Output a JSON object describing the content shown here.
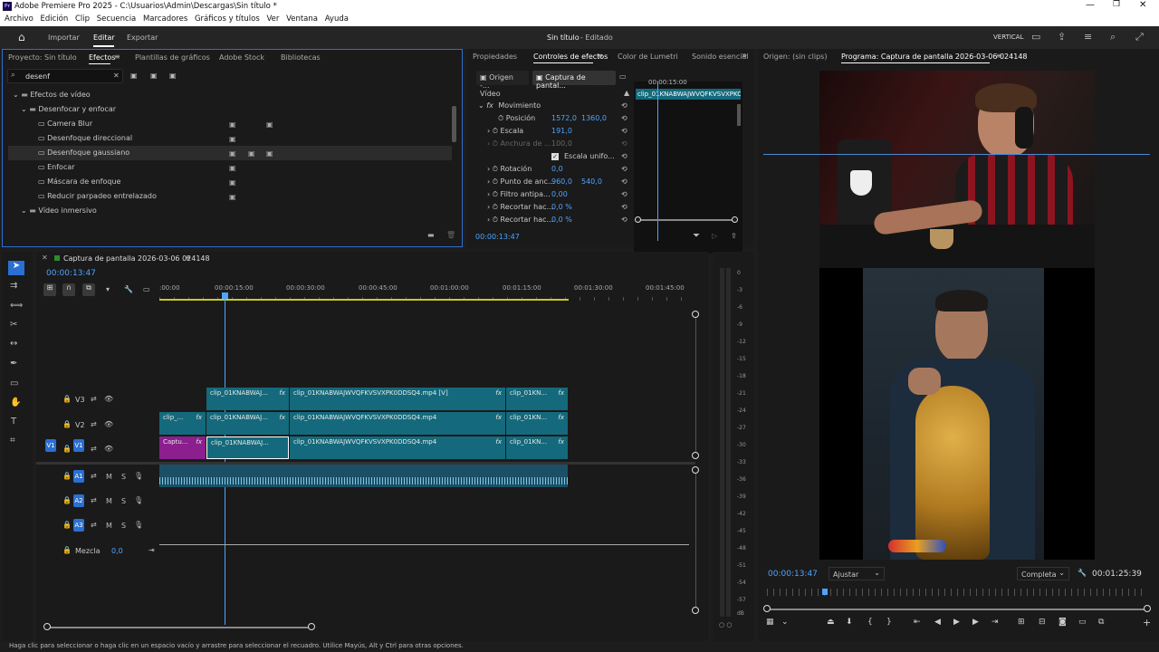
{
  "window": {
    "title": "Adobe Premiere Pro 2025 - C:\\Usuarios\\Admin\\Descargas\\Sin título *",
    "app_badge": "Pr"
  },
  "menu": [
    "Archivo",
    "Edición",
    "Clip",
    "Secuencia",
    "Marcadores",
    "Gráficos y títulos",
    "Ver",
    "Ventana",
    "Ayuda"
  ],
  "appbar": {
    "tabs": [
      "Importar",
      "Editar",
      "Exportar"
    ],
    "project_title": "Sin título",
    "project_state": "- Editado",
    "layout": "VERTICAL"
  },
  "effects_panel": {
    "tabs": [
      "Proyecto: Sin título",
      "Efectos",
      "Plantillas de gráficos",
      "Adobe Stock",
      "Bibliotecas"
    ],
    "search_value": "desenf",
    "tree": [
      {
        "label": "Efectos de vídeo",
        "level": 0
      },
      {
        "label": "Desenfocar y enfocar",
        "level": 1
      },
      {
        "label": "Camera Blur",
        "level": 2
      },
      {
        "label": "Desenfoque direccional",
        "level": 2
      },
      {
        "label": "Desenfoque gaussiano",
        "level": 2
      },
      {
        "label": "Enfocar",
        "level": 2
      },
      {
        "label": "Máscara de enfoque",
        "level": 2
      },
      {
        "label": "Reducir parpadeo entrelazado",
        "level": 2
      },
      {
        "label": "Vídeo inmersivo",
        "level": 1
      }
    ]
  },
  "effect_controls": {
    "tabs": [
      "Propiedades",
      "Controles de efectos",
      "Color de Lumetri",
      "Sonido esencial"
    ],
    "source_tab": "Origen -...",
    "clip_tab": "Captura de pantal...",
    "section": "Vídeo",
    "mini_clip": "clip_01KNABWAJWVQFKVSVXPKC",
    "mini_time": "00:00:15:00",
    "rows": [
      {
        "label": "Movimiento",
        "v1": "",
        "v2": ""
      },
      {
        "label": "Posición",
        "v1": "1572,0",
        "v2": "1360,0"
      },
      {
        "label": "Escala",
        "v1": "191,0",
        "v2": ""
      },
      {
        "label": "Anchura de ...",
        "v1": "100,0",
        "v2": ""
      },
      {
        "label": "Escala unifo...",
        "v1": "",
        "v2": ""
      },
      {
        "label": "Rotación",
        "v1": "0,0",
        "v2": ""
      },
      {
        "label": "Punto de anc...",
        "v1": "960,0",
        "v2": "540,0"
      },
      {
        "label": "Filtro antipa...",
        "v1": "0,00",
        "v2": ""
      },
      {
        "label": "Recortar hac...",
        "v1": "0,0 %",
        "v2": ""
      },
      {
        "label": "Recortar hac...",
        "v1": "0,0 %",
        "v2": ""
      }
    ],
    "timecode": "00:00:13:47"
  },
  "timeline": {
    "sequence_name": "Captura de pantalla 2026-03-06 024148",
    "timecode": "00:00:13:47",
    "ruler": [
      ":00:00",
      "00:00:15:00",
      "00:00:30:00",
      "00:00:45:00",
      "00:01:00:00",
      "00:01:15:00",
      "00:01:30:00",
      "00:01:45:00"
    ],
    "video_tracks": [
      "V3",
      "V2",
      "V1"
    ],
    "audio_tracks": [
      "A1",
      "A2",
      "A3"
    ],
    "src_v1": "V1",
    "mix_label": "Mezcla",
    "mix_value": "0,0",
    "clips": {
      "v3_a": "clip_01KNABWAJ...",
      "v3_b": "clip_01KNABWAJWVQFKVSVXPK0DDSQ4.mp4 [V]",
      "v3_c": "clip_01KN...",
      "v2_a": "clip_...",
      "v2_b": "clip_01KNABWAJ...",
      "v2_c": "clip_01KNABWAJWVQFKVSVXPK0DDSQ4.mp4",
      "v2_d": "clip_01KN...",
      "v1_a": "Captu...",
      "v1_b": "clip_01KNABWAJ...",
      "v1_c": "clip_01KNABWAJWVQFKVSVXPK0DDSQ4.mp4",
      "v1_d": "clip_01KN...",
      "fx": "fx"
    },
    "track_btn_m": "M",
    "track_btn_s": "S"
  },
  "meters": [
    "0",
    "-3",
    "-6",
    "-9",
    "-12",
    "-15",
    "-18",
    "-21",
    "-24",
    "-27",
    "-30",
    "-33",
    "-36",
    "-39",
    "-42",
    "-45",
    "-48",
    "-51",
    "-54",
    "-57",
    "dB"
  ],
  "meter_footer": "○ ○",
  "program": {
    "source_tab": "Origen: (sin clips)",
    "program_tab": "Programa: Captura de pantalla 2026-03-06 024148",
    "timecode": "00:00:13:47",
    "fit": "Ajustar",
    "quality": "Completa",
    "duration": "00:01:25:39"
  },
  "status_bar": "Haga clic para seleccionar o haga clic en un espacio vacío y arrastre para seleccionar el recuadro. Utilice Mayús, Alt y Ctrl para otras opciones.",
  "colors": {
    "accent": "#2b6fd1",
    "clip": "#146a7c",
    "clip_pink": "#8a1f8d",
    "audio": "#1b4f66"
  }
}
